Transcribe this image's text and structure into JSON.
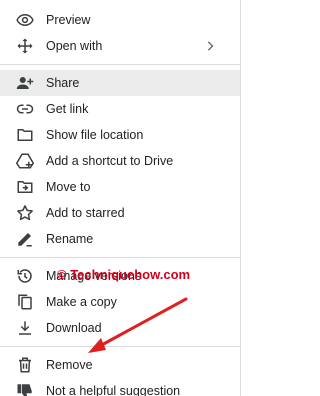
{
  "menu": {
    "group1": [
      {
        "label": "Preview",
        "icon": "eye-icon"
      },
      {
        "label": "Open with",
        "icon": "move-arrows-icon",
        "submenu": true
      }
    ],
    "group2": [
      {
        "label": "Share",
        "icon": "person-add-icon",
        "highlighted": true
      },
      {
        "label": "Get link",
        "icon": "link-icon"
      },
      {
        "label": "Show file location",
        "icon": "folder-icon"
      },
      {
        "label": "Add a shortcut to Drive",
        "icon": "drive-shortcut-icon"
      },
      {
        "label": "Move to",
        "icon": "move-to-folder-icon"
      },
      {
        "label": "Add to starred",
        "icon": "star-icon"
      },
      {
        "label": "Rename",
        "icon": "pencil-icon"
      }
    ],
    "group3": [
      {
        "label": "Manage versions",
        "icon": "history-icon"
      },
      {
        "label": "Make a copy",
        "icon": "copy-icon"
      },
      {
        "label": "Download",
        "icon": "download-icon"
      }
    ],
    "group4": [
      {
        "label": "Remove",
        "icon": "trash-icon"
      },
      {
        "label": "Not a helpful suggestion",
        "icon": "thumbs-down-icon"
      }
    ]
  },
  "watermark": {
    "text": "© Techniquehow.com",
    "color": "#d0021b"
  },
  "colors": {
    "highlight": "#ebebeb",
    "divider": "#dadce0",
    "text": "#1f1f1f",
    "arrow": "#e02020"
  }
}
